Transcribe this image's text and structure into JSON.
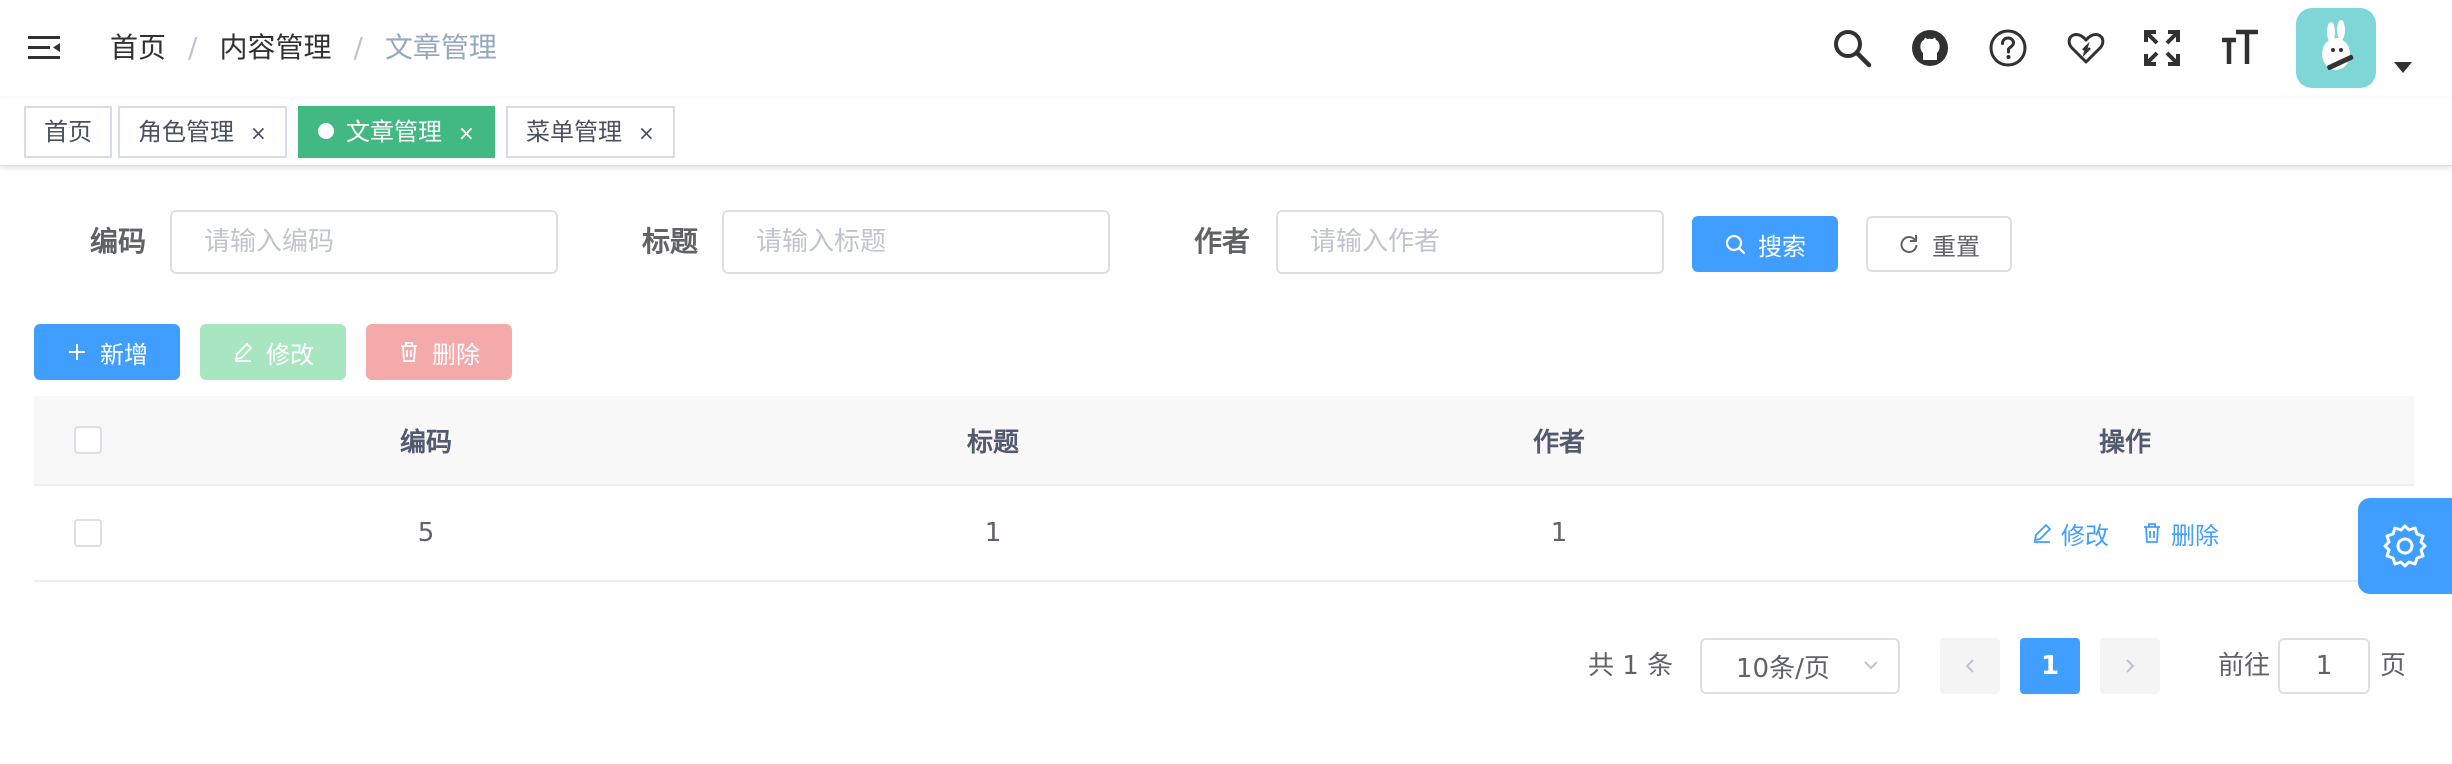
{
  "breadcrumb": {
    "items": [
      "首页",
      "内容管理",
      "文章管理"
    ],
    "separator": "/"
  },
  "header_icons": [
    "search-icon",
    "github-icon",
    "question-icon",
    "heart-icon",
    "fullscreen-icon",
    "font-size-icon"
  ],
  "tags": [
    {
      "label": "首页",
      "closable": false,
      "active": false
    },
    {
      "label": "角色管理",
      "closable": true,
      "active": false
    },
    {
      "label": "文章管理",
      "closable": true,
      "active": true
    },
    {
      "label": "菜单管理",
      "closable": true,
      "active": false
    }
  ],
  "tag_close": "×",
  "search_form": {
    "code_label": "编码",
    "code_placeholder": "请输入编码",
    "title_label": "标题",
    "title_placeholder": "请输入标题",
    "author_label": "作者",
    "author_placeholder": "请输入作者",
    "search_button": "搜索",
    "reset_button": "重置"
  },
  "toolbar": {
    "add": "新增",
    "edit": "修改",
    "delete": "删除"
  },
  "table": {
    "columns": [
      "编码",
      "标题",
      "作者",
      "操作"
    ],
    "rows": [
      {
        "code": "5",
        "title": "1",
        "author": "1"
      }
    ],
    "row_actions": {
      "edit": "修改",
      "delete": "删除"
    }
  },
  "pagination": {
    "total_text": "共 1 条",
    "page_size": "10条/页",
    "current_page": "1",
    "goto_prefix": "前往",
    "goto_value": "1",
    "goto_suffix": "页"
  },
  "colors": {
    "primary": "#409eff",
    "tag_active": "#42b983",
    "success_disabled": "#a8e6c2",
    "danger_disabled": "#f4aaaa",
    "avatar_bg": "#7fd6d6"
  }
}
